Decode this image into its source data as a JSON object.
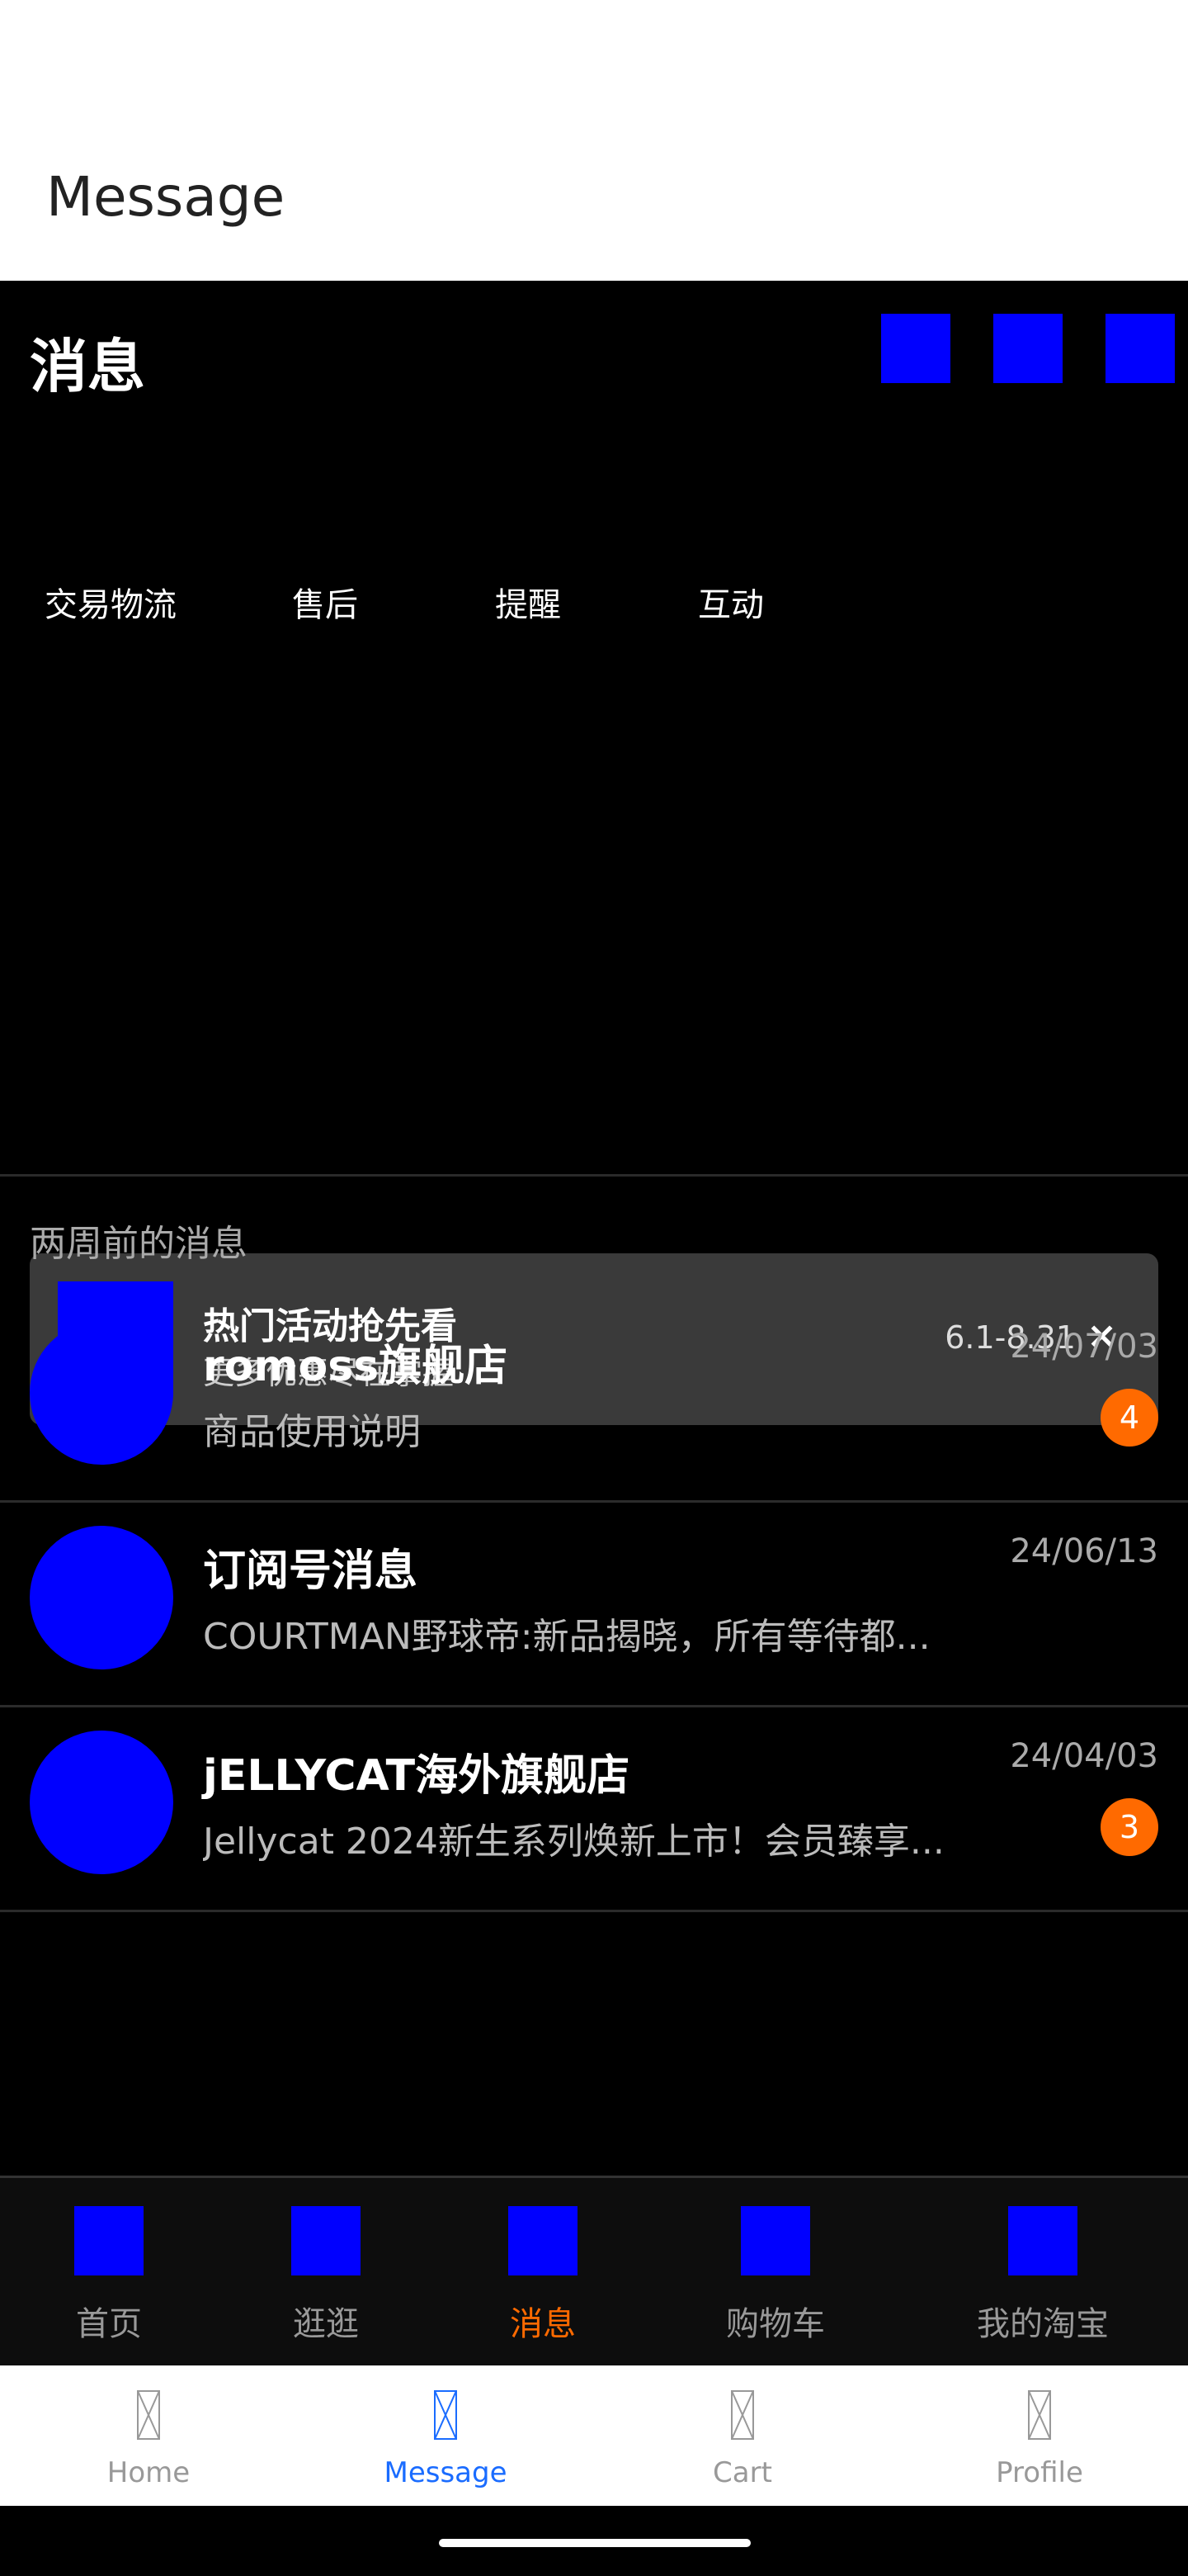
{
  "app_header": {
    "title": "Message"
  },
  "page": {
    "title": "消息",
    "top_actions": [
      "action-icon-1",
      "action-icon-2",
      "action-icon-3"
    ],
    "tabs": [
      {
        "label": "交易物流"
      },
      {
        "label": "售后"
      },
      {
        "label": "提醒"
      },
      {
        "label": "互动"
      }
    ]
  },
  "promo": {
    "title": "热门活动抢先看",
    "subtitle": "更多优惠尽在掌握",
    "date_range": "6.1-8.31",
    "close": "×"
  },
  "section_label": "两周前的消息",
  "conversations": [
    {
      "name": "romoss旗舰店",
      "preview": "商品使用说明",
      "date": "24/07/03",
      "badge": "4"
    },
    {
      "name": "订阅号消息",
      "preview": "COURTMAN野球帝:新品揭晓，所有等待都...",
      "date": "24/06/13",
      "badge": ""
    },
    {
      "name": "jELLYCAT海外旗舰店",
      "preview": "Jellycat 2024新生系列焕新上市！会员臻享...",
      "date": "24/04/03",
      "badge": "3"
    }
  ],
  "inner_tabbar": [
    {
      "label": "首页"
    },
    {
      "label": "逛逛"
    },
    {
      "label": "消息",
      "active": true
    },
    {
      "label": "购物车"
    },
    {
      "label": "我的淘宝"
    }
  ],
  "host_nav": [
    {
      "label": "Home"
    },
    {
      "label": "Message",
      "active": true
    },
    {
      "label": "Cart"
    },
    {
      "label": "Profile"
    }
  ],
  "colors": {
    "accent_orange": "#ff6a00",
    "host_active": "#1a6cff",
    "placeholder_blue": "#0000ff"
  }
}
